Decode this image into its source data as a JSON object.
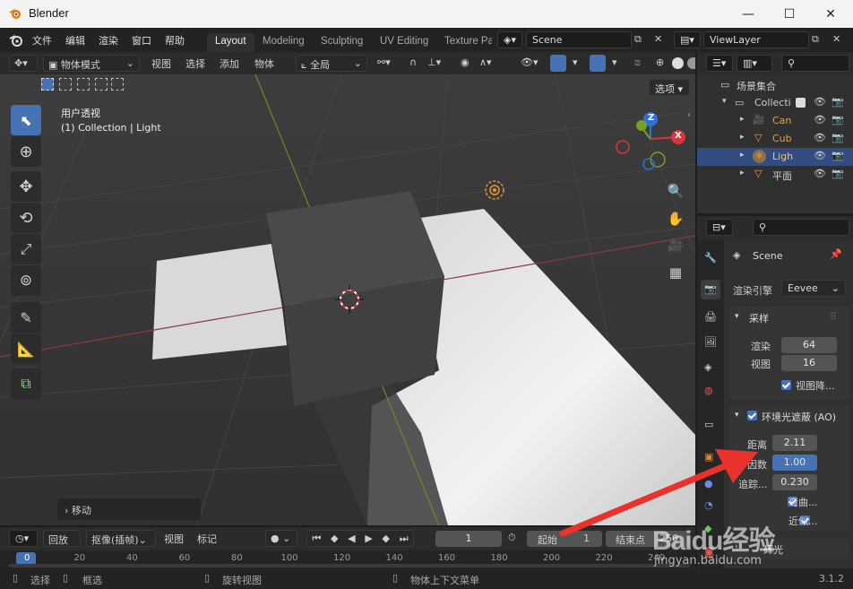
{
  "window": {
    "title": "Blender",
    "version": "3.1.2"
  },
  "menu": {
    "items": [
      "文件",
      "编辑",
      "渲染",
      "窗口",
      "帮助"
    ]
  },
  "workspace_tabs": [
    {
      "label": "Layout",
      "active": true
    },
    {
      "label": "Modeling"
    },
    {
      "label": "Sculpting"
    },
    {
      "label": "UV Editing"
    },
    {
      "label": "Texture Pa"
    }
  ],
  "scene": {
    "name": "Scene",
    "view_layer": "ViewLayer"
  },
  "viewport_header": {
    "mode": "物体模式",
    "menus": [
      "视图",
      "选择",
      "添加",
      "物体"
    ],
    "transform": "全局"
  },
  "viewport": {
    "options": "选项",
    "perspective_label": "用户透视",
    "collection_label": "(1) Collection | Light",
    "last_op": "移动",
    "axes": {
      "x": "X",
      "y": "Y",
      "z": "Z"
    }
  },
  "outliner": {
    "root": "场景集合",
    "collection": "Collecti",
    "items": [
      {
        "label": "Can",
        "icon": "camera-icon"
      },
      {
        "label": "Cub",
        "icon": "mesh-icon"
      },
      {
        "label": "Ligh",
        "icon": "light-icon",
        "selected": true
      },
      {
        "label": "平面",
        "icon": "mesh-icon"
      }
    ]
  },
  "properties": {
    "scene_label": "Scene",
    "render_engine_label": "渲染引擎",
    "render_engine": "Eevee",
    "sampling": {
      "title": "采样",
      "render_label": "渲染",
      "render_value": "64",
      "viewport_label": "视图",
      "viewport_value": "16",
      "denoise_label": "视图降..."
    },
    "ao": {
      "title": "环境光遮蔽 (AO)",
      "distance_label": "距离",
      "distance_value": "2.11",
      "factor_label": "因数",
      "factor_value": "1.00",
      "trace_label": "追踪...",
      "trace_value": "0.230",
      "bent_label": "弯曲...",
      "approx_label": "近似..."
    },
    "bloom": {
      "title": "辉光"
    }
  },
  "timeline": {
    "playback": "回放",
    "keying": "抠像(插帧)",
    "view": "视图",
    "marker": "标记",
    "current_frame": "1",
    "start_label": "起始",
    "start_value": "1",
    "end_label": "结束点",
    "end_value": "250"
  },
  "ruler": {
    "ticks": [
      "0",
      "20",
      "40",
      "60",
      "80",
      "100",
      "120",
      "140",
      "160",
      "180",
      "200",
      "220",
      "240"
    ]
  },
  "status": {
    "select": "选择",
    "box_select": "框选",
    "rotate_view": "旋转视图",
    "context_menu": "物体上下文菜单"
  },
  "watermark": {
    "brand": "Baidu经验",
    "url": "jingyan.baidu.com"
  }
}
